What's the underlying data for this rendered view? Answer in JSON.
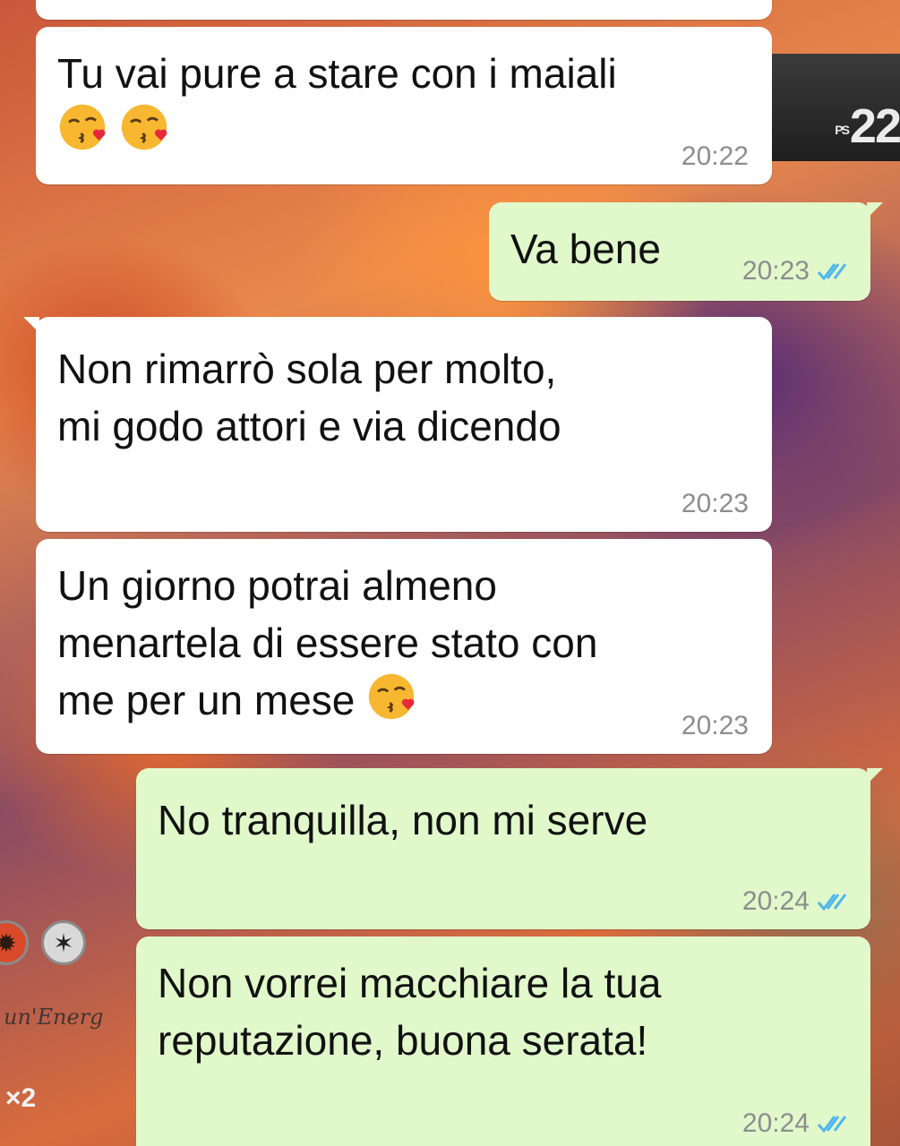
{
  "background": {
    "ps_prefix": "PS",
    "ps_value": "22",
    "energy_text": "un'Energ",
    "retreat": "×2"
  },
  "colors": {
    "incoming_bubble": "#ffffff",
    "outgoing_bubble": "#e1f8cb",
    "timestamp": "#8d8d8d",
    "read_tick": "#4fb6ec"
  },
  "messages": [
    {
      "direction": "incoming",
      "text": "Tu vai pure a stare con i maiali",
      "emojis": [
        "kissing-face-with-heart-icon",
        "kissing-face-with-heart-icon"
      ],
      "time": "20:22"
    },
    {
      "direction": "outgoing",
      "text": "Va bene",
      "time": "20:23",
      "status": "read"
    },
    {
      "direction": "incoming",
      "text": "Non rimarrò sola per molto,\nmi godo attori e via dicendo",
      "time": "20:23"
    },
    {
      "direction": "incoming",
      "text": "Un giorno potrai almeno\nmenartela di essere stato con\nme per un mese",
      "emojis": [
        "kissing-face-with-heart-icon"
      ],
      "time": "20:23"
    },
    {
      "direction": "outgoing",
      "text": "No tranquilla, non mi serve",
      "time": "20:24",
      "status": "read"
    },
    {
      "direction": "outgoing",
      "text": "Non vorrei macchiare la tua\nreputazione, buona serata!",
      "time": "20:24",
      "status": "read"
    }
  ]
}
